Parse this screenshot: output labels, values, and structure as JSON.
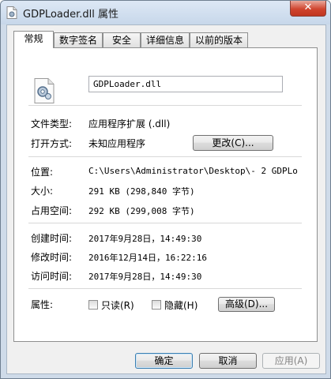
{
  "window": {
    "title": "GDPLoader.dll 属性",
    "close_label": "✕"
  },
  "tabs": [
    {
      "label": "常规",
      "active": true
    },
    {
      "label": "数字签名",
      "active": false
    },
    {
      "label": "安全",
      "active": false
    },
    {
      "label": "详细信息",
      "active": false
    },
    {
      "label": "以前的版本",
      "active": false
    }
  ],
  "general": {
    "file_name": "GDPLoader.dll",
    "file_type_label": "文件类型:",
    "file_type_value": "应用程序扩展 (.dll)",
    "opens_with_label": "打开方式:",
    "opens_with_value": "未知应用程序",
    "change_button": "更改(C)...",
    "location_label": "位置:",
    "location_value": "C:\\Users\\Administrator\\Desktop\\-  2 GDPLo",
    "size_label": "大小:",
    "size_value": "291 KB (298,840 字节)",
    "size_on_disk_label": "占用空间:",
    "size_on_disk_value": "292 KB (299,008 字节)",
    "created_label": "创建时间:",
    "created_value": "2017年9月28日，14:49:30",
    "modified_label": "修改时间:",
    "modified_value": "2016年12月14日，16:22:16",
    "accessed_label": "访问时间:",
    "accessed_value": "2017年9月28日，14:49:30",
    "attributes_label": "属性:",
    "readonly_label": "只读(R)",
    "hidden_label": "隐藏(H)",
    "advanced_button": "高级(D)..."
  },
  "footer": {
    "ok": "确定",
    "cancel": "取消",
    "apply": "应用(A)"
  }
}
